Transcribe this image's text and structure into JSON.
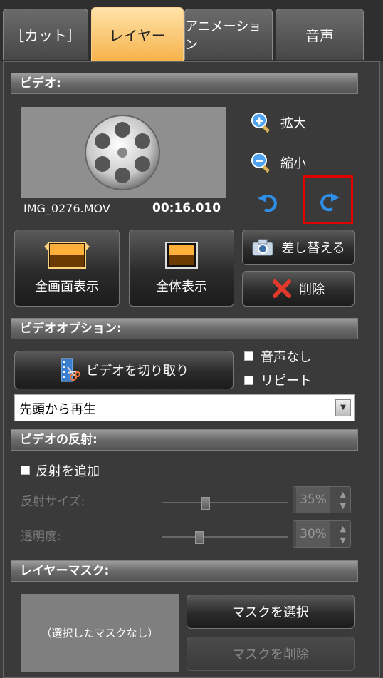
{
  "tabs": [
    {
      "label": "［カット］"
    },
    {
      "label": "レイヤー"
    },
    {
      "label": "アニメーション"
    },
    {
      "label": "音声"
    }
  ],
  "video": {
    "section_title": "ビデオ:",
    "filename": "IMG_0276.MOV",
    "duration": "00:16.010",
    "zoom_in_label": "拡大",
    "zoom_out_label": "縮小",
    "fullscreen_label": "全画面表示",
    "fit_label": "全体表示",
    "replace_label": "差し替える",
    "delete_label": "削除"
  },
  "video_options": {
    "section_title": "ビデオオプション:",
    "trim_label": "ビデオを切り取り",
    "mute_label": "音声なし",
    "repeat_label": "リピート",
    "play_mode_value": "先頭から再生"
  },
  "reflection": {
    "section_title": "ビデオの反射:",
    "add_label": "反射を追加",
    "size_label": "反射サイズ:",
    "size_value": "35%",
    "opacity_label": "透明度:",
    "opacity_value": "30%"
  },
  "mask": {
    "section_title": "レイヤーマスク:",
    "preview_text": "（選択したマスクなし）",
    "select_label": "マスクを選択",
    "delete_label": "マスクを削除"
  },
  "colors": {
    "active_tab": "#f6b24b",
    "highlight_box": "#e00000",
    "icon_blue": "#2f8fe8"
  }
}
